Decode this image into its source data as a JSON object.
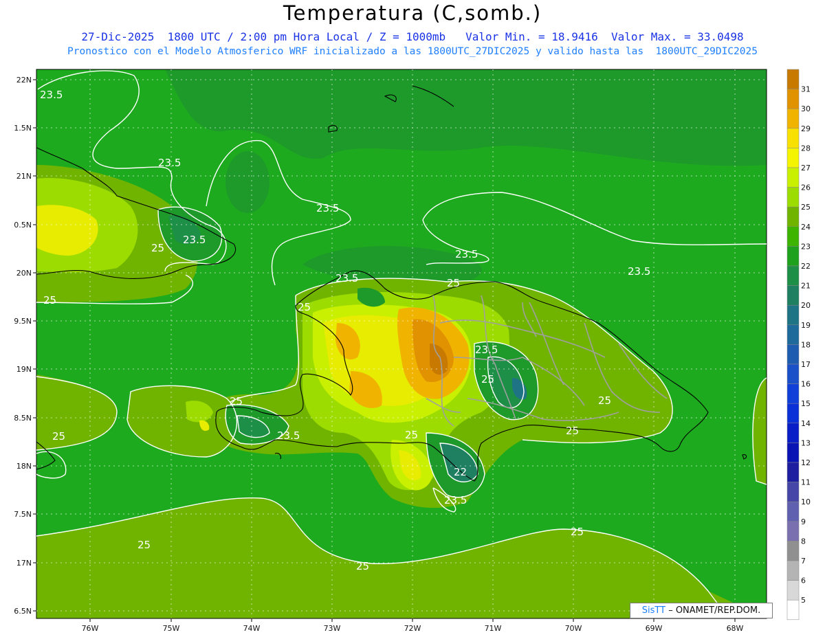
{
  "title": "Temperatura (C,somb.)",
  "subtitle_line1": "27-Dic-2025  1800 UTC / 2:00 pm Hora Local / Z = 1000mb   Valor Min. = 18.9416  Valor Max. = 33.0498",
  "subtitle_line2": "Pronostico con el Modelo Atmosferico WRF inicializado a las 1800UTC_27DIC2025 y valido hasta las  1800UTC_29DIC2025",
  "lat_labels": [
    "22N",
    "1.5N",
    "21N",
    "0.5N",
    "20N",
    "9.5N",
    "19N",
    "8.5N",
    "18N",
    "7.5N",
    "17N",
    "6.5N"
  ],
  "lon_labels": [
    "76W",
    "75W",
    "74W",
    "73W",
    "72W",
    "71W",
    "70W",
    "69W",
    "68W"
  ],
  "colorbar_labels": [
    "31",
    "30",
    "29",
    "28",
    "27",
    "26",
    "25",
    "24",
    "23",
    "22",
    "21",
    "20",
    "19",
    "18",
    "17",
    "16",
    "15",
    "14",
    "13",
    "12",
    "11",
    "10",
    "9",
    "8",
    "7",
    "6",
    "5"
  ],
  "colorbar_colors": [
    "#c87a00",
    "#e09200",
    "#f0b400",
    "#f8e000",
    "#f4f400",
    "#c8f000",
    "#9cdc00",
    "#70b400",
    "#3cb400",
    "#1ea21e",
    "#1e8f46",
    "#1e8060",
    "#1e7484",
    "#1e6a9a",
    "#1e5cb0",
    "#1a50c8",
    "#1040d8",
    "#0a30d8",
    "#0a1ec8",
    "#0a14b4",
    "#1e1ea0",
    "#4646a8",
    "#6060b0",
    "#7a70b0",
    "#909090",
    "#b4b4b4",
    "#d8d8d8",
    "#ffffff"
  ],
  "contour_labels": {
    "c1": "23.5",
    "c2": "23.5",
    "c3": "23.5",
    "c4": "23.5",
    "c5": "23.5",
    "c6": "23.5",
    "c7": "23.5",
    "c8": "23.5",
    "c9": "23.5",
    "c10": "25",
    "c11": "25",
    "c12": "25",
    "c13": "25",
    "c14": "25",
    "c15": "25",
    "c16": "25",
    "c17": "25",
    "c18": "25",
    "c19": "25",
    "c20": "25",
    "c21": "22"
  },
  "credit": {
    "brand": "SisTT",
    "text": " –  ONAMET/REP.DOM."
  }
}
